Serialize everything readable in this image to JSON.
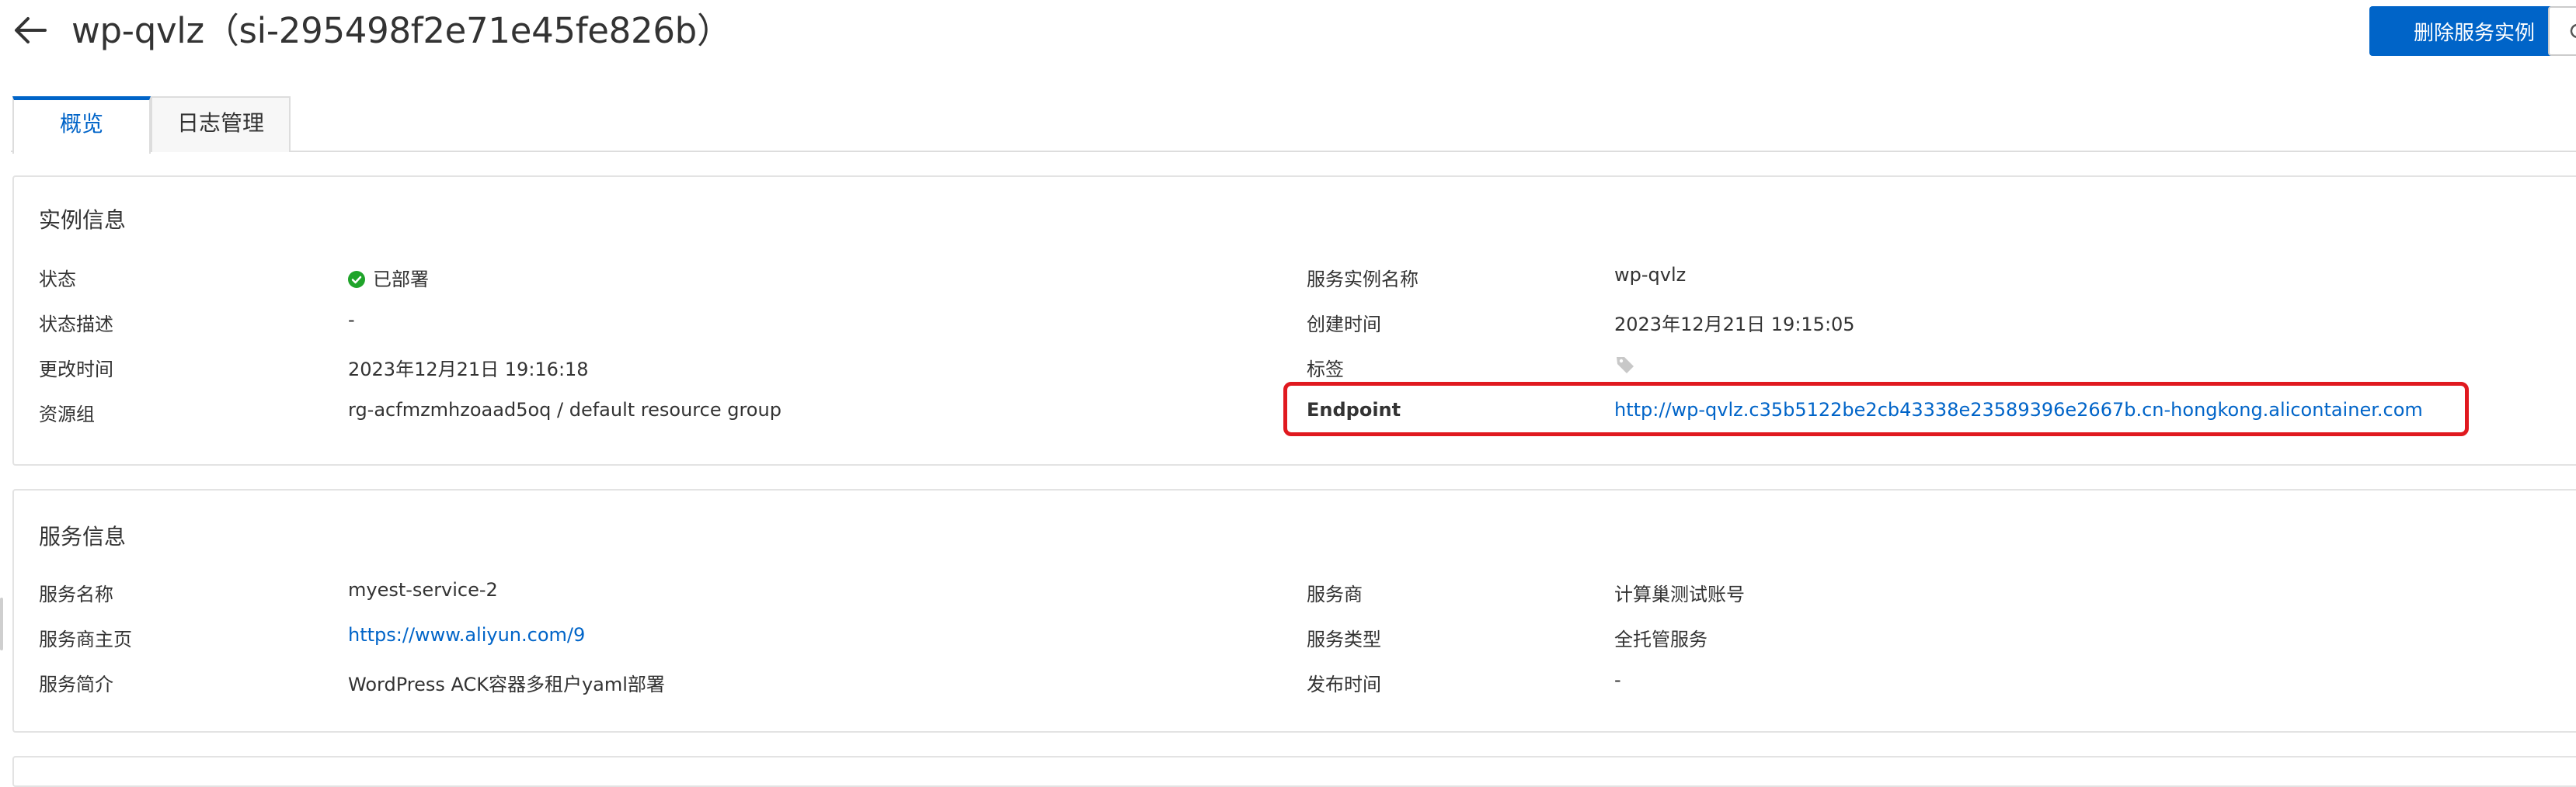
{
  "header": {
    "title": "wp-qvlz（si-295498f2e71e45fe826b）",
    "delete_button": "删除服务实例"
  },
  "tabs": [
    {
      "label": "概览",
      "active": true
    },
    {
      "label": "日志管理",
      "active": false
    }
  ],
  "instance_info": {
    "title": "实例信息",
    "left": [
      {
        "label": "状态",
        "value": "已部署"
      },
      {
        "label": "状态描述",
        "value": "-"
      },
      {
        "label": "更改时间",
        "value": "2023年12月21日 19:16:18"
      },
      {
        "label": "资源组",
        "value": "rg-acfmzmhzoaad5oq / default resource group"
      }
    ],
    "right": [
      {
        "label": "服务实例名称",
        "value": "wp-qvlz"
      },
      {
        "label": "创建时间",
        "value": "2023年12月21日 19:15:05"
      },
      {
        "label": "标签",
        "value": ""
      },
      {
        "label": "Endpoint",
        "value": "http://wp-qvlz.c35b5122be2cb43338e23589396e2667b.cn-hongkong.alicontainer.com"
      }
    ]
  },
  "service_info": {
    "title": "服务信息",
    "left": [
      {
        "label": "服务名称",
        "value": "myest-service-2"
      },
      {
        "label": "服务商主页",
        "value": "https://www.aliyun.com/9"
      },
      {
        "label": "服务简介",
        "value": "WordPress ACK容器多租户yaml部署"
      }
    ],
    "right": [
      {
        "label": "服务商",
        "value": "计算巢测试账号"
      },
      {
        "label": "服务类型",
        "value": "全托管服务"
      },
      {
        "label": "发布时间",
        "value": "-"
      }
    ]
  },
  "colors": {
    "primary": "#0064c8",
    "status_success": "#1fa42a",
    "highlight": "#e0191f"
  },
  "icons": [
    "back-arrow-icon",
    "refresh-icon",
    "check-circle-icon",
    "tag-icon"
  ]
}
